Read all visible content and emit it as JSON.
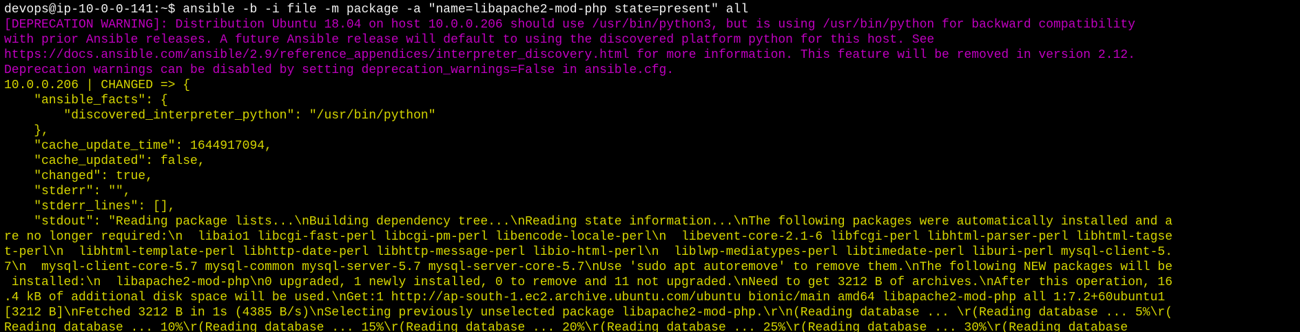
{
  "terminal": {
    "prompt_line": "devops@ip-10-0-0-141:~$ ansible -b -i file -m package -a \"name=libapache2-mod-php state=present\" all",
    "deprecation": [
      "[DEPRECATION WARNING]: Distribution Ubuntu 18.04 on host 10.0.0.206 should use /usr/bin/python3, but is using /usr/bin/python for backward compatibility",
      "with prior Ansible releases. A future Ansible release will default to using the discovered platform python for this host. See",
      "https://docs.ansible.com/ansible/2.9/reference_appendices/interpreter_discovery.html for more information. This feature will be removed in version 2.12.",
      "Deprecation warnings can be disabled by setting deprecation_warnings=False in ansible.cfg."
    ],
    "output": [
      "10.0.0.206 | CHANGED => {",
      "    \"ansible_facts\": {",
      "        \"discovered_interpreter_python\": \"/usr/bin/python\"",
      "    },",
      "    \"cache_update_time\": 1644917094,",
      "    \"cache_updated\": false,",
      "    \"changed\": true,",
      "    \"stderr\": \"\",",
      "    \"stderr_lines\": [],",
      "    \"stdout\": \"Reading package lists...\\nBuilding dependency tree...\\nReading state information...\\nThe following packages were automatically installed and a",
      "re no longer required:\\n  libaio1 libcgi-fast-perl libcgi-pm-perl libencode-locale-perl\\n  libevent-core-2.1-6 libfcgi-perl libhtml-parser-perl libhtml-tagse",
      "t-perl\\n  libhtml-template-perl libhttp-date-perl libhttp-message-perl libio-html-perl\\n  liblwp-mediatypes-perl libtimedate-perl liburi-perl mysql-client-5.",
      "7\\n  mysql-client-core-5.7 mysql-common mysql-server-5.7 mysql-server-core-5.7\\nUse 'sudo apt autoremove' to remove them.\\nThe following NEW packages will be",
      " installed:\\n  libapache2-mod-php\\n0 upgraded, 1 newly installed, 0 to remove and 11 not upgraded.\\nNeed to get 3212 B of archives.\\nAfter this operation, 16",
      ".4 kB of additional disk space will be used.\\nGet:1 http://ap-south-1.ec2.archive.ubuntu.com/ubuntu bionic/main amd64 libapache2-mod-php all 1:7.2+60ubuntu1",
      "[3212 B]\\nFetched 3212 B in 1s (4385 B/s)\\nSelecting previously unselected package libapache2-mod-php.\\r\\n(Reading database ... \\r(Reading database ... 5%\\r(",
      "Reading database ... 10%\\r(Reading database ... 15%\\r(Reading database ... 20%\\r(Reading database ... 25%\\r(Reading database ... 30%\\r(Reading database"
    ],
    "colors": {
      "background": "#000000",
      "prompt": "#f2f2f2",
      "warning": "#c000c0",
      "output": "#d6d600"
    }
  }
}
